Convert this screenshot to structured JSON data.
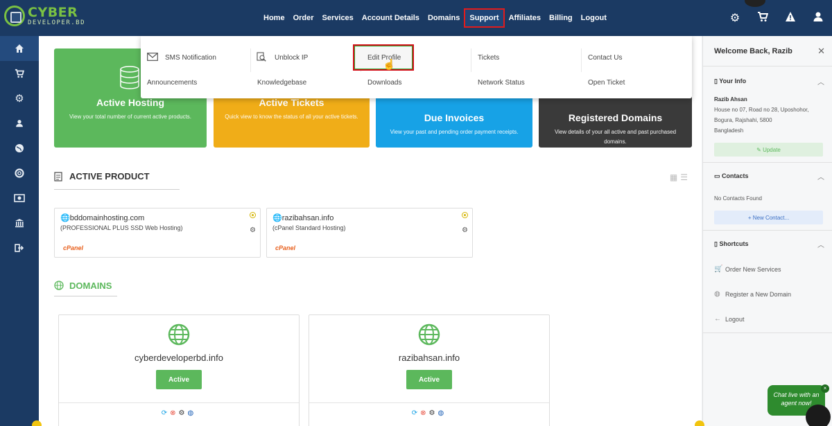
{
  "brand": {
    "line1": "CYBER",
    "line2": "DEVELOPER.BD"
  },
  "nav": {
    "items": [
      "Home",
      "Order",
      "Services",
      "Account Details",
      "Domains",
      "Support",
      "Affiliates",
      "Billing",
      "Logout"
    ],
    "active": "Support"
  },
  "top_icons": [
    "gear-icon",
    "cart-icon",
    "alert-icon",
    "user-icon"
  ],
  "sidebar_icons": [
    "home-icon",
    "cart-icon",
    "gears-icon",
    "user-icon",
    "globe-icon",
    "lifebuoy-icon",
    "money-icon",
    "bank-icon",
    "signout-icon"
  ],
  "dropdown": {
    "items": [
      {
        "label": "SMS Notification",
        "icon": "envelope-icon"
      },
      {
        "label": "Unblock IP",
        "icon": "search-doc-icon"
      },
      {
        "label": "Edit Profile",
        "icon": ""
      },
      {
        "label": "Tickets",
        "icon": ""
      },
      {
        "label": "Contact Us",
        "icon": ""
      },
      {
        "label": "Announcements",
        "icon": ""
      },
      {
        "label": "Knowledgebase",
        "icon": ""
      },
      {
        "label": "Downloads",
        "icon": ""
      },
      {
        "label": "Network Status",
        "icon": ""
      },
      {
        "label": "Open Ticket",
        "icon": ""
      }
    ]
  },
  "tiles": [
    {
      "title": "Active Hosting",
      "desc": "View your total number of current active products.",
      "color": "#5cb85c"
    },
    {
      "title": "Active Tickets",
      "desc": "Quick view to know the  status of all your active tickets.",
      "color": "#f0ad18"
    },
    {
      "title": "Due Invoices",
      "desc": "View your past and pending order payment receipts.",
      "color": "#17a2e6"
    },
    {
      "title": "Registered Domains",
      "desc": "View details of your all active and past purchased domains.",
      "color": "#3a3a3a"
    }
  ],
  "active_product": {
    "title": "ACTIVE PRODUCT",
    "products": [
      {
        "domain": "bddomainhosting.com",
        "plan": "(PROFESSIONAL PLUS SSD Web Hosting)",
        "badge": "cPanel"
      },
      {
        "domain": "razibahsan.info",
        "plan": "(cPanel Standard Hosting)",
        "badge": "cPanel"
      }
    ]
  },
  "domains": {
    "title": "DOMAINS",
    "items": [
      {
        "name": "cyberdeveloperbd.info",
        "status": "Active"
      },
      {
        "name": "razibahsan.info",
        "status": "Active"
      }
    ]
  },
  "right_panel": {
    "welcome": "Welcome Back, Razib",
    "your_info": {
      "title": "Your Info",
      "name": "Razib Ahsan",
      "address1": "House no 07, Road no 28, Uposhohor,",
      "address2": "Bogura, Rajshahi, 5800",
      "country": "Bangladesh",
      "update_label": "Update"
    },
    "contacts": {
      "title": "Contacts",
      "empty": "No Contacts Found",
      "new_label": "New Contact..."
    },
    "shortcuts": {
      "title": "Shortcuts",
      "items": [
        "Order New Services",
        "Register a New Domain",
        "Logout"
      ]
    }
  },
  "chat": {
    "text1": "Chat live with an",
    "text2": "agent now!",
    "close": "×"
  }
}
